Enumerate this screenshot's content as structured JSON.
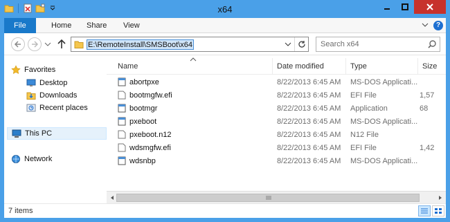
{
  "window": {
    "title": "x64"
  },
  "ribbon": {
    "tabs": [
      "File",
      "Home",
      "Share",
      "View"
    ],
    "help": "?"
  },
  "address": {
    "path": "E:\\RemoteInstall\\SMSBoot\\x64"
  },
  "search": {
    "placeholder": "Search x64"
  },
  "sidebar": {
    "items": [
      {
        "label": "Favorites",
        "icon": "star-icon"
      },
      {
        "label": "Desktop",
        "icon": "desktop-icon"
      },
      {
        "label": "Downloads",
        "icon": "downloads-icon"
      },
      {
        "label": "Recent places",
        "icon": "recent-places-icon"
      },
      {
        "label": "This PC",
        "icon": "computer-icon"
      },
      {
        "label": "Network",
        "icon": "network-icon"
      }
    ]
  },
  "columns": [
    "Name",
    "Date modified",
    "Type",
    "Size"
  ],
  "files": [
    {
      "name": "abortpxe",
      "date": "8/22/2013 6:45 AM",
      "type": "MS-DOS Applicati...",
      "size": ""
    },
    {
      "name": "bootmgfw.efi",
      "date": "8/22/2013 6:45 AM",
      "type": "EFI File",
      "size": "1,57"
    },
    {
      "name": "bootmgr",
      "date": "8/22/2013 6:45 AM",
      "type": "Application",
      "size": "68"
    },
    {
      "name": "pxeboot",
      "date": "8/22/2013 6:45 AM",
      "type": "MS-DOS Applicati...",
      "size": ""
    },
    {
      "name": "pxeboot.n12",
      "date": "8/22/2013 6:45 AM",
      "type": "N12 File",
      "size": ""
    },
    {
      "name": "wdsmgfw.efi",
      "date": "8/22/2013 6:45 AM",
      "type": "EFI File",
      "size": "1,42"
    },
    {
      "name": "wdsnbp",
      "date": "8/22/2013 6:45 AM",
      "type": "MS-DOS Applicati...",
      "size": ""
    }
  ],
  "status": {
    "count": "7 items"
  },
  "colors": {
    "titlebar": "#4aa0e8",
    "file_tab": "#1979ca",
    "close": "#c7322c",
    "selection": "#cfe4f8"
  }
}
